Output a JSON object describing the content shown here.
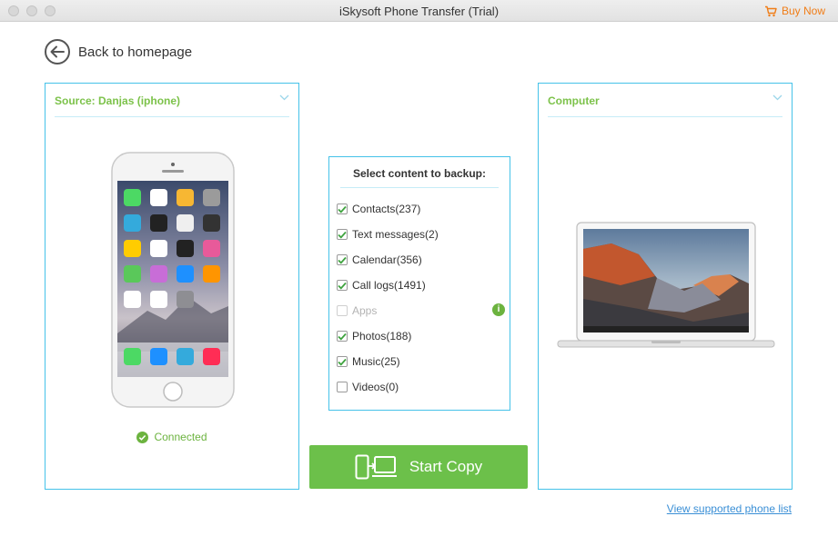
{
  "window": {
    "title": "iSkysoft Phone Transfer (Trial)",
    "buy_now": "Buy Now"
  },
  "nav": {
    "back_label": "Back to homepage"
  },
  "source": {
    "title": "Source: Danjas (iphone)",
    "status": "Connected"
  },
  "destination": {
    "title": "Computer"
  },
  "content": {
    "title": "Select content to backup:",
    "items": [
      {
        "label": "Contacts(237)",
        "checked": true
      },
      {
        "label": "Text messages(2)",
        "checked": true
      },
      {
        "label": "Calendar(356)",
        "checked": true
      },
      {
        "label": "Call logs(1491)",
        "checked": true
      },
      {
        "label": "Apps",
        "checked": false,
        "disabled": true
      },
      {
        "label": "Photos(188)",
        "checked": true
      },
      {
        "label": "Music(25)",
        "checked": true
      },
      {
        "label": "Videos(0)",
        "checked": false
      }
    ]
  },
  "actions": {
    "start_label": "Start Copy"
  },
  "footer": {
    "supported_link": "View supported phone list"
  },
  "colors": {
    "accent_blue": "#45c2e9",
    "green": "#6cc04a",
    "orange": "#f07d17",
    "link": "#3a8fd6"
  }
}
